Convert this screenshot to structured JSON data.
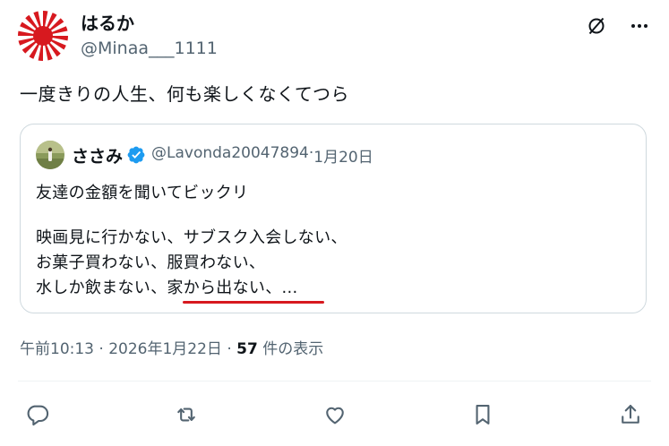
{
  "tweet": {
    "author": {
      "display_name": "はるか",
      "handle": "@Minaa___1111"
    },
    "text": "一度きりの人生、何も楽しくなくてつら",
    "header_icons": [
      "grok-icon",
      "more-icon"
    ]
  },
  "quote": {
    "author": {
      "display_name": "ささみ",
      "handle": "@Lavonda20047894",
      "separator": " · ",
      "date": "1月20日"
    },
    "lines": [
      "友達の金額を聞いてビックリ",
      "",
      "映画見に行かない、サブスク入会しない、",
      "お菓子買わない、服買わない、",
      "水しか飲まない、家から出ない、..."
    ],
    "highlight_color": "#d7191f"
  },
  "meta": {
    "time": "午前10:13",
    "separator1": " · ",
    "date": "2026年1月22日",
    "separator2": " · ",
    "views_count": "57",
    "views_label": " 件の表示"
  },
  "actions": [
    {
      "name": "reply",
      "icon": "reply-icon"
    },
    {
      "name": "retweet",
      "icon": "retweet-icon"
    },
    {
      "name": "like",
      "icon": "heart-icon"
    },
    {
      "name": "bookmark",
      "icon": "bookmark-icon"
    },
    {
      "name": "share",
      "icon": "share-icon"
    }
  ],
  "colors": {
    "text": "#0f1419",
    "secondary": "#536471",
    "border": "#cfd9de",
    "verified": "#1d9bf0"
  }
}
